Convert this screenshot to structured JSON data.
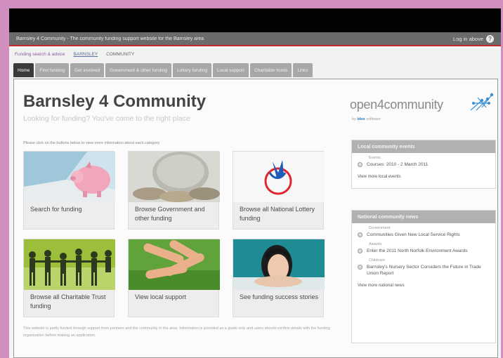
{
  "header": {
    "site_bar_text": "Barnsley 4 Community - The community funding support website for the Barnsley area",
    "login_label": "Log in above",
    "help_glyph": "?"
  },
  "breadcrumbs": [
    "Funding search & advice",
    "BARNSLEY",
    "COMMUNITY"
  ],
  "tabs": [
    {
      "label": "Home",
      "active": true
    },
    {
      "label": "Find funding",
      "active": false
    },
    {
      "label": "Get involved",
      "active": false
    },
    {
      "label": "Government & other funding",
      "active": false
    },
    {
      "label": "Lottery funding",
      "active": false
    },
    {
      "label": "Local support",
      "active": false
    },
    {
      "label": "Charitable trusts",
      "active": false
    },
    {
      "label": "Links",
      "active": false
    }
  ],
  "main": {
    "title": "Barnsley 4 Community",
    "subtitle": "Looking for funding? You've come to the right place",
    "intro": "Please click on the buttons below to view more information about each category",
    "cards": [
      {
        "label": "Search for funding"
      },
      {
        "label": "Browse Government and other funding"
      },
      {
        "label": "Browse all National Lottery funding"
      },
      {
        "label": "Browse all Charitable Trust funding"
      },
      {
        "label": "View local support"
      },
      {
        "label": "See funding success stories"
      }
    ],
    "footer_text": "This website is partly funded through support from partners and the community in the area. Information is provided as a guide only and users should confirm details with the funding organisation before making an application."
  },
  "logo": {
    "name": "open4community",
    "sub_prefix": "by",
    "sub_brand": "idox",
    "sub_suffix": "software"
  },
  "events_box": {
    "title": "Local community events",
    "category": "Events",
    "items": [
      "Courses: 2010 - 2 March 2011"
    ],
    "more_link": "View more local events"
  },
  "news_box": {
    "title": "National community news",
    "items": [
      {
        "category": "Government",
        "text": "Communities Given New Local Service Rights"
      },
      {
        "category": "Awards",
        "text": "Enter the 2011 North Norfolk Environment Awards"
      },
      {
        "category": "Childcare",
        "text": "Barnsley's Nursery Sector Considers the Future in Trade Union Report"
      }
    ],
    "more_link": "View more national news"
  },
  "colors": {
    "page_background": "#d08fbe",
    "top_bar": "#6b6b6b",
    "accent_line": "#c1272d",
    "active_tab": "#3a3a3a",
    "tab": "#a8a8a8",
    "box_header": "#b1b1b1"
  }
}
